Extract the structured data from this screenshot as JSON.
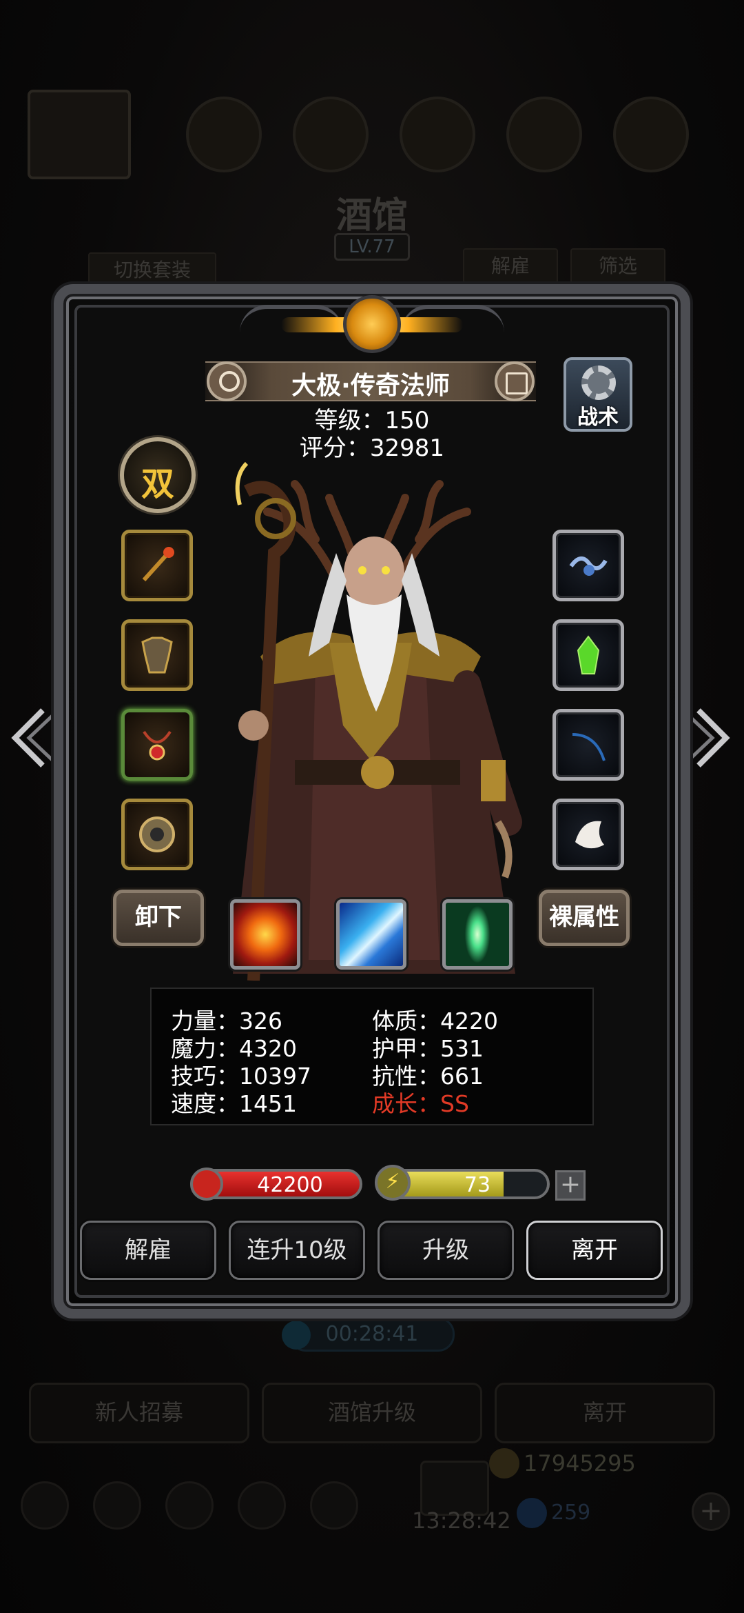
{
  "background": {
    "title": "酒馆",
    "level": "LV.77",
    "switch_outfit": "切换套装",
    "dismiss": "解雇",
    "filter": "筛选",
    "timer": "00:28:41",
    "recruit": "新人招募",
    "upgrade_tavern": "酒馆升级",
    "leave": "离开",
    "gold": "17945295",
    "gems": "259",
    "clock": "13:28:42"
  },
  "hero": {
    "name": "大极·传奇法师",
    "level_text": "等级：150",
    "score_text": "评分：32981",
    "tactics_label": "战术",
    "class_glyph": "双"
  },
  "equipment": {
    "left": [
      "staff",
      "armor",
      "amulet",
      "medal"
    ],
    "right": [
      "wave-orb",
      "green-crystal",
      "blue-feather",
      "white-fur"
    ]
  },
  "buttons": {
    "unequip": "卸下",
    "base_stats": "裸属性"
  },
  "skills": [
    "fire-burst",
    "ice-slash",
    "green-light"
  ],
  "stats": {
    "strength": "力量：326",
    "magic": "魔力：4320",
    "skill": "技巧：10397",
    "speed": "速度：1451",
    "constitution": "体质：4220",
    "armor": "护甲：531",
    "resistance": "抗性：661",
    "growth": "成长：SS"
  },
  "bars": {
    "hp": "42200",
    "energy": "73",
    "energy_fraction": 0.73
  },
  "actions": {
    "dismiss": "解雇",
    "level_up_10": "连升10级",
    "level_up": "升级",
    "leave": "离开"
  },
  "colors": {
    "growth": "#e23a26",
    "hp": "#d12a26",
    "energy": "#d8cc3a"
  }
}
